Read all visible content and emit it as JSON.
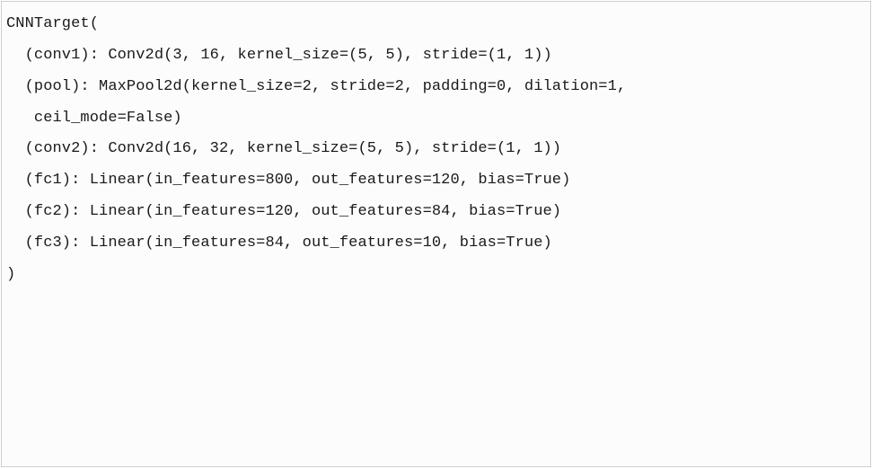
{
  "code": {
    "lines": [
      "CNNTarget(",
      "  (conv1): Conv2d(3, 16, kernel_size=(5, 5), stride=(1, 1))",
      "  (pool): MaxPool2d(kernel_size=2, stride=2, padding=0, dilation=1,",
      "   ceil_mode=False)",
      "  (conv2): Conv2d(16, 32, kernel_size=(5, 5), stride=(1, 1))",
      "  (fc1): Linear(in_features=800, out_features=120, bias=True)",
      "  (fc2): Linear(in_features=120, out_features=84, bias=True)",
      "  (fc3): Linear(in_features=84, out_features=10, bias=True)",
      ")"
    ]
  }
}
